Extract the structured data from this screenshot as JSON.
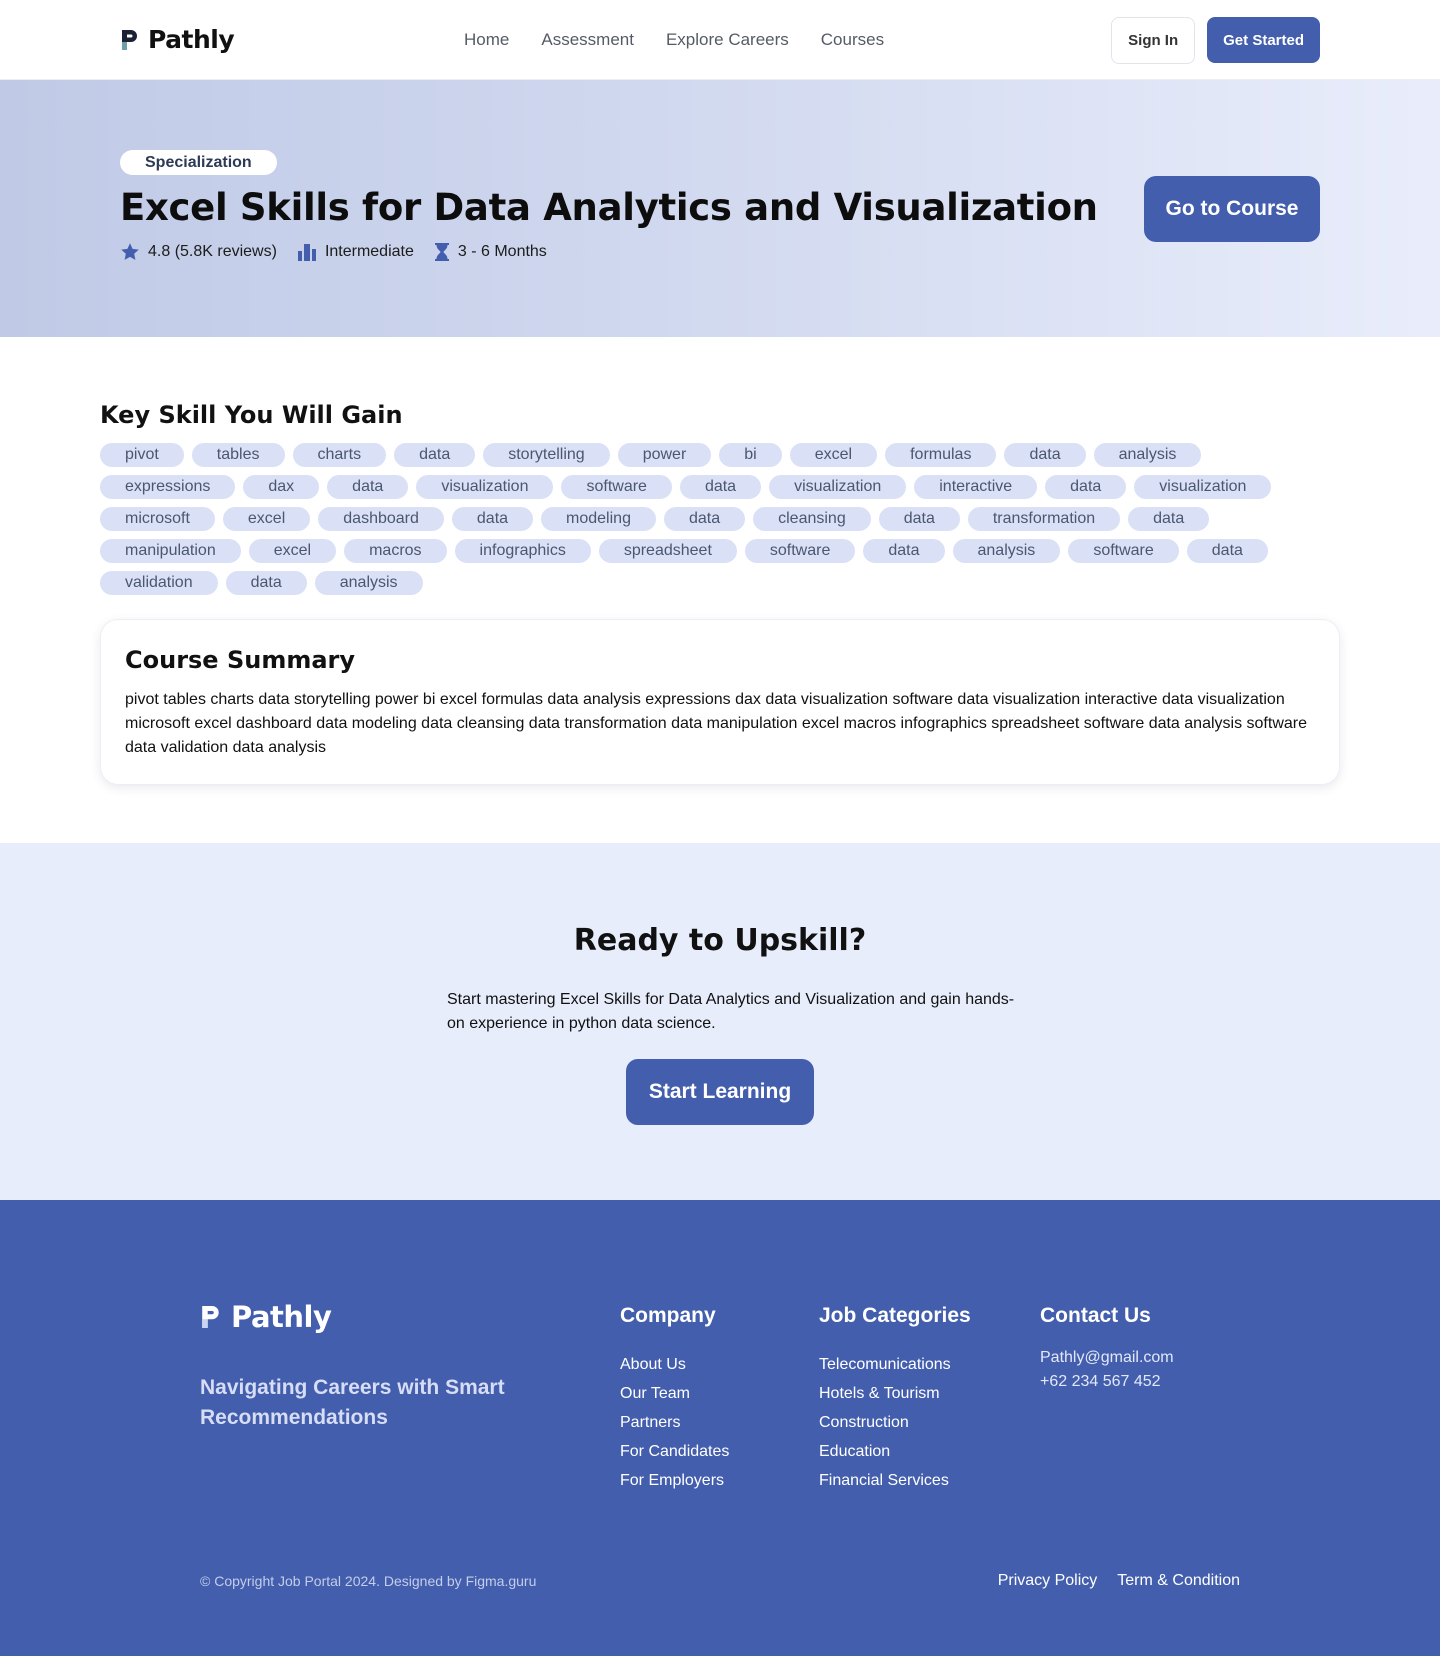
{
  "brand": {
    "name": "Pathly"
  },
  "nav": {
    "items": [
      "Home",
      "Assessment",
      "Explore Careers",
      "Courses"
    ]
  },
  "header": {
    "signin_label": "Sign In",
    "getstarted_label": "Get Started"
  },
  "hero": {
    "badge": "Specialization",
    "title": "Excel Skills for Data Analytics and Visualization",
    "rating": "4.8 (5.8K reviews)",
    "level": "Intermediate",
    "duration": "3 - 6 Months",
    "cta_label": "Go to Course"
  },
  "skills": {
    "heading": "Key Skill You Will Gain",
    "tags": [
      "pivot",
      "tables",
      "charts",
      "data",
      "storytelling",
      "power",
      "bi",
      "excel",
      "formulas",
      "data",
      "analysis",
      "expressions",
      "dax",
      "data",
      "visualization",
      "software",
      "data",
      "visualization",
      "interactive",
      "data",
      "visualization",
      "microsoft",
      "excel",
      "dashboard",
      "data",
      "modeling",
      "data",
      "cleansing",
      "data",
      "transformation",
      "data",
      "manipulation",
      "excel",
      "macros",
      "infographics",
      "spreadsheet",
      "software",
      "data",
      "analysis",
      "software",
      "data",
      "validation",
      "data",
      "analysis"
    ]
  },
  "summary": {
    "heading": "Course Summary",
    "text": "pivot tables charts data storytelling power bi excel formulas data analysis expressions dax data visualization software data visualization interactive data visualization microsoft excel dashboard data modeling data cleansing data transformation data manipulation excel macros infographics spreadsheet software data analysis software data validation data analysis"
  },
  "cta": {
    "heading": "Ready to Upskill?",
    "text": "Start mastering Excel Skills for Data Analytics and Visualization and gain hands-on experience in python data science.",
    "button_label": "Start Learning"
  },
  "footer": {
    "tagline": "Navigating Careers with Smart Recommendations",
    "company": {
      "heading": "Company",
      "links": [
        "About Us",
        "Our Team",
        "Partners",
        "For Candidates",
        "For Employers"
      ]
    },
    "jobs": {
      "heading": "Job Categories",
      "links": [
        "Telecomunications",
        "Hotels & Tourism",
        "Construction",
        "Education",
        "Financial Services"
      ]
    },
    "contact": {
      "heading": "Contact Us",
      "email": "Pathly@gmail.com",
      "phone": "+62 234 567 452"
    },
    "copyright": "© Copyright Job Portal 2024. Designed by Figma.guru",
    "legal": [
      "Privacy Policy",
      "Term & Condition"
    ]
  },
  "colors": {
    "primary": "#435ead",
    "tag_bg": "#dae1f6",
    "cta_bg": "#e8edfc"
  },
  "icons": {
    "rating": "star-icon",
    "level": "bar-chart-icon",
    "duration": "hourglass-icon"
  }
}
